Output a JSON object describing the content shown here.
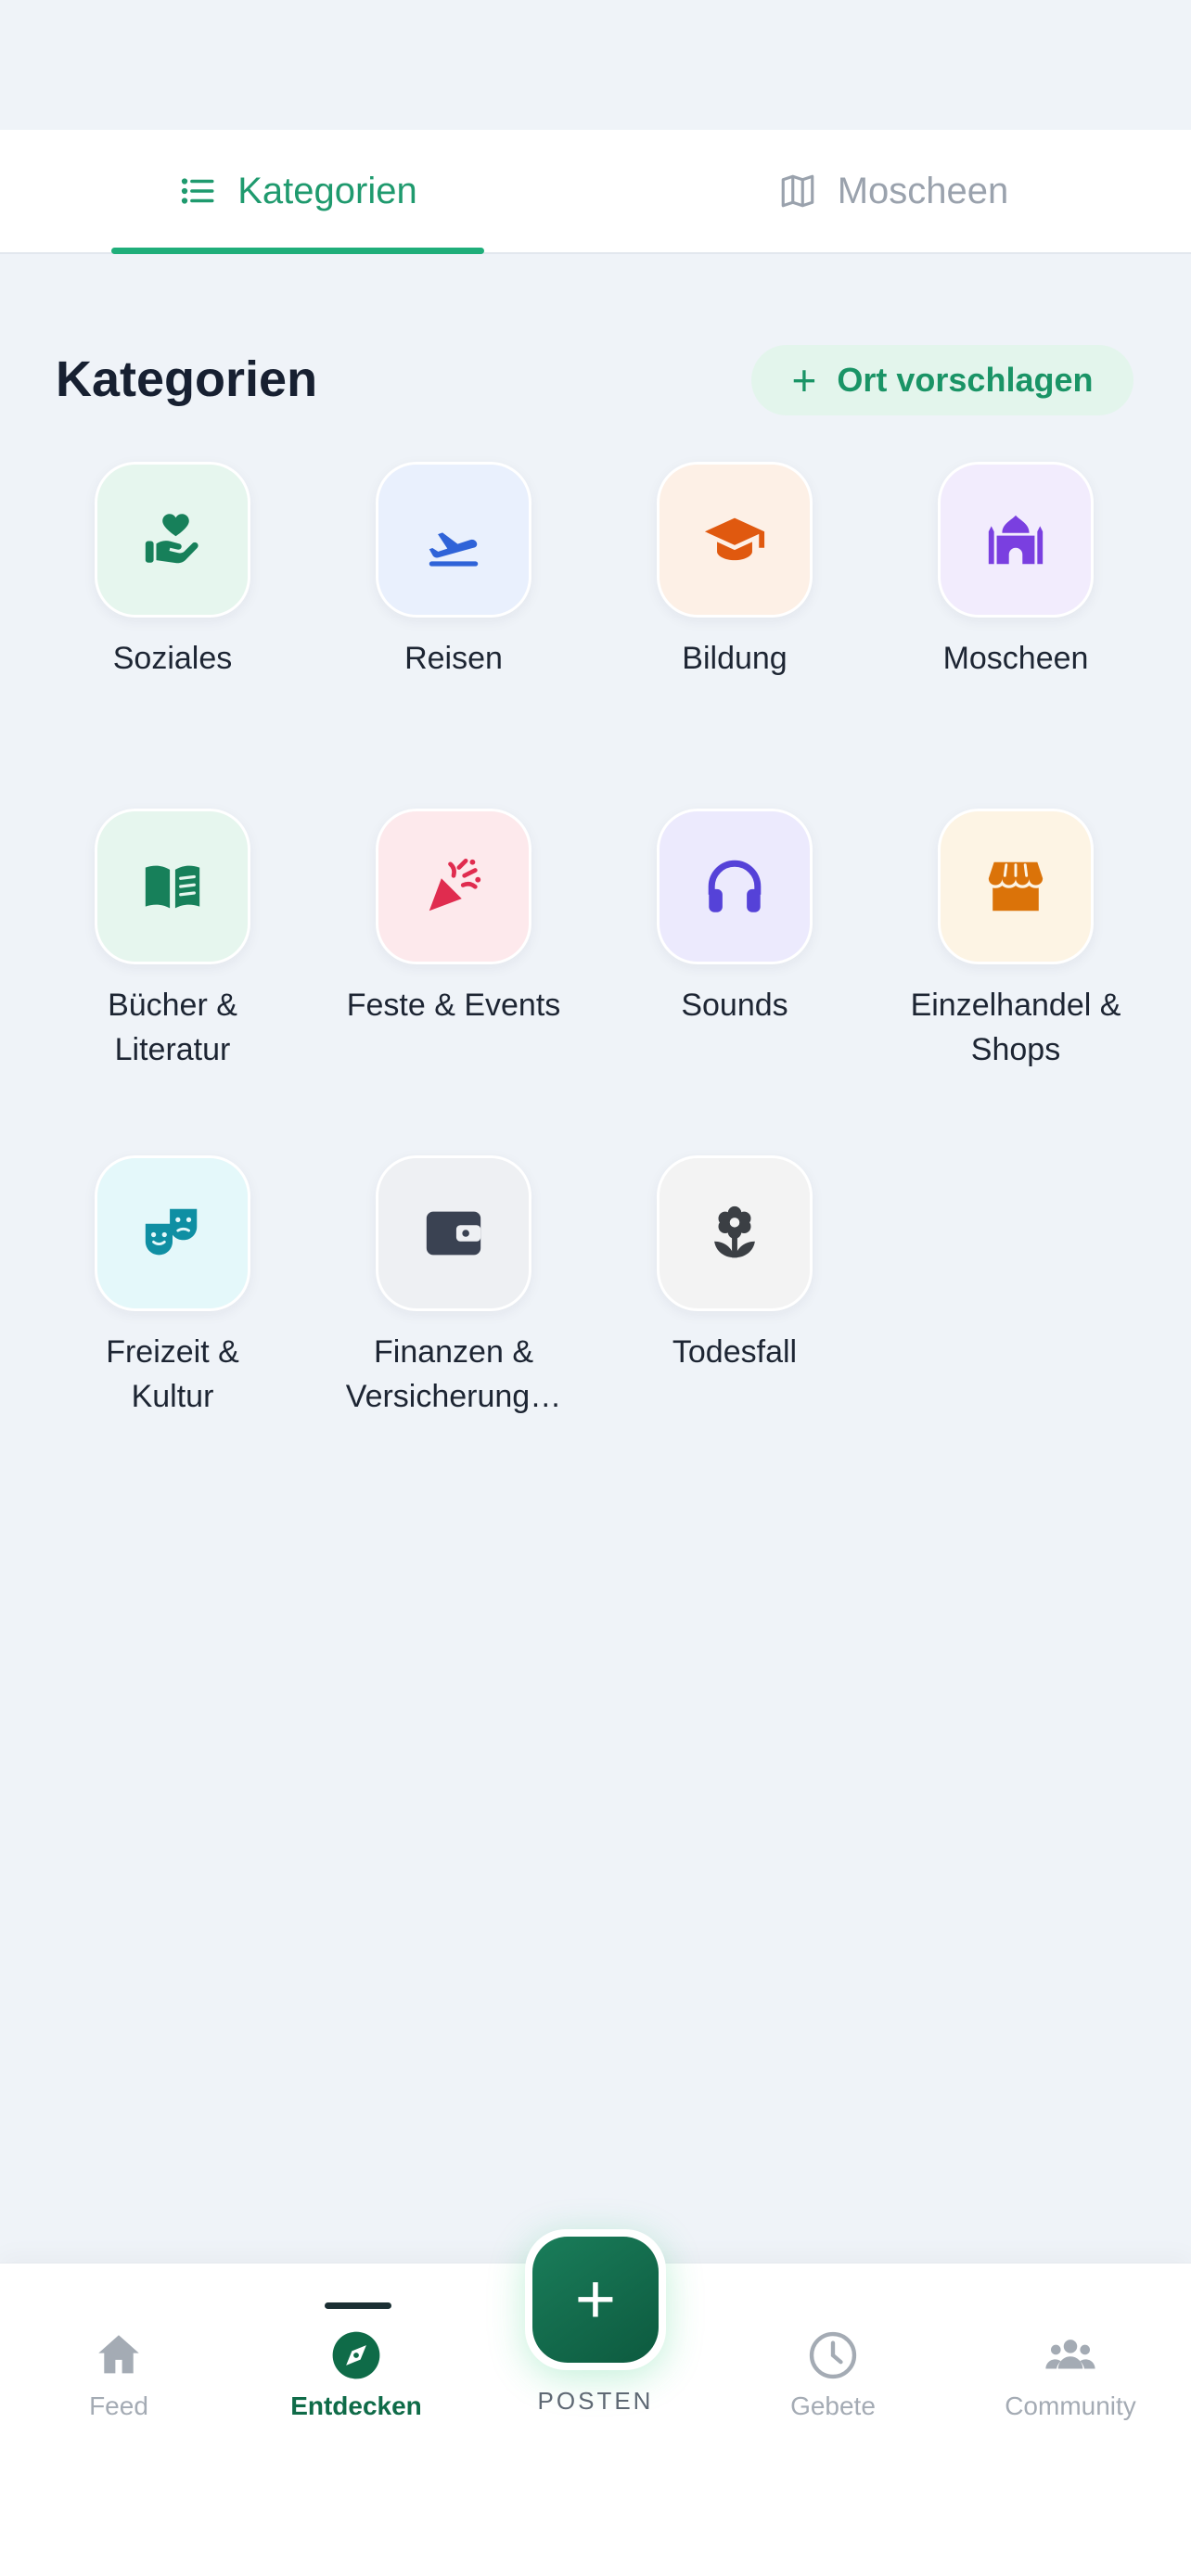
{
  "tabs": [
    {
      "label": "Kategorien",
      "icon": "list-icon",
      "active": true
    },
    {
      "label": "Moscheen",
      "icon": "map-icon",
      "active": false
    }
  ],
  "section": {
    "title": "Kategorien",
    "suggest_label": "Ort vorschlagen"
  },
  "categories": [
    {
      "label": "Soziales",
      "icon": "hand-heart-icon",
      "color": "#17805a",
      "bg": "#e6f6ee"
    },
    {
      "label": "Reisen",
      "icon": "plane-departure-icon",
      "color": "#2f63d8",
      "bg": "#e9f0fd"
    },
    {
      "label": "Bildung",
      "icon": "graduation-cap-icon",
      "color": "#e0590f",
      "bg": "#fdf0e6"
    },
    {
      "label": "Moscheen",
      "icon": "mosque-icon",
      "color": "#7a3fe0",
      "bg": "#f2ecfd"
    },
    {
      "label": "Bücher & Literatur",
      "icon": "book-open-icon",
      "color": "#17805a",
      "bg": "#e6f6ee"
    },
    {
      "label": "Feste & Events",
      "icon": "party-popper-icon",
      "color": "#e02c4f",
      "bg": "#fde9ec"
    },
    {
      "label": "Sounds",
      "icon": "headphones-icon",
      "color": "#5542d8",
      "bg": "#eceafd"
    },
    {
      "label": "Einzelhandel & Shops",
      "icon": "store-icon",
      "color": "#db7309",
      "bg": "#fdf4e4"
    },
    {
      "label": "Freizeit & Kultur",
      "icon": "theater-masks-icon",
      "color": "#0f8fa3",
      "bg": "#e4f8fa"
    },
    {
      "label": "Finanzen & Versicherung…",
      "icon": "wallet-icon",
      "color": "#3a4252",
      "bg": "#eef0f3"
    },
    {
      "label": "Todesfall",
      "icon": "flower-icon",
      "color": "#3b3f44",
      "bg": "#f3f3f3"
    }
  ],
  "nav": {
    "items": [
      {
        "label": "Feed",
        "icon": "home-icon",
        "active": false
      },
      {
        "label": "Entdecken",
        "icon": "compass-icon",
        "active": true
      },
      {
        "label": "Gebete",
        "icon": "clock-icon",
        "active": false
      },
      {
        "label": "Community",
        "icon": "users-icon",
        "active": false
      }
    ],
    "post_label": "POSTEN",
    "post_icon": "plus-icon"
  }
}
